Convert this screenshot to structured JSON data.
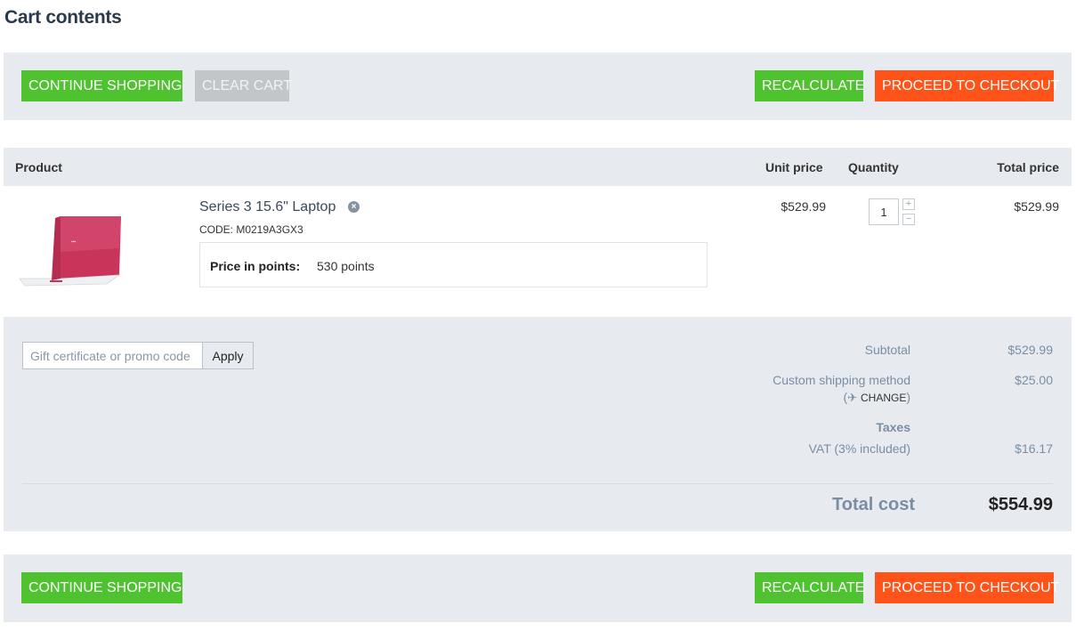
{
  "page": {
    "title": "Cart contents"
  },
  "actions": {
    "continue_shopping": "CONTINUE SHOPPING",
    "clear_cart": "CLEAR CART",
    "recalculate": "RECALCULATE",
    "checkout": "PROCEED TO CHECKOUT"
  },
  "table": {
    "headers": {
      "product": "Product",
      "unit_price": "Unit price",
      "quantity": "Quantity",
      "total_price": "Total price"
    }
  },
  "item": {
    "name": "Series 3 15.6\" Laptop",
    "code": "CODE: M0219A3GX3",
    "points_label": "Price in points:",
    "points_value": "530 points",
    "unit_price": "$529.99",
    "quantity": "1",
    "total_price": "$529.99",
    "image_icon": "laptop-image",
    "color": "#c8345a"
  },
  "promo": {
    "placeholder": "Gift certificate or promo code",
    "apply_label": "Apply"
  },
  "summary": {
    "subtotal_label": "Subtotal",
    "subtotal_value": "$529.99",
    "shipping_label": "Custom shipping method",
    "shipping_value": "$25.00",
    "change_label": "CHANGE",
    "taxes_label": "Taxes",
    "vat_label": "VAT (3% included)",
    "vat_value": "$16.17",
    "total_label": "Total cost",
    "total_value": "$554.99"
  },
  "colors": {
    "green": "#4ec22f",
    "orange": "#ff5319",
    "gray": "#c3c6c8",
    "panel": "#e7ebef"
  }
}
